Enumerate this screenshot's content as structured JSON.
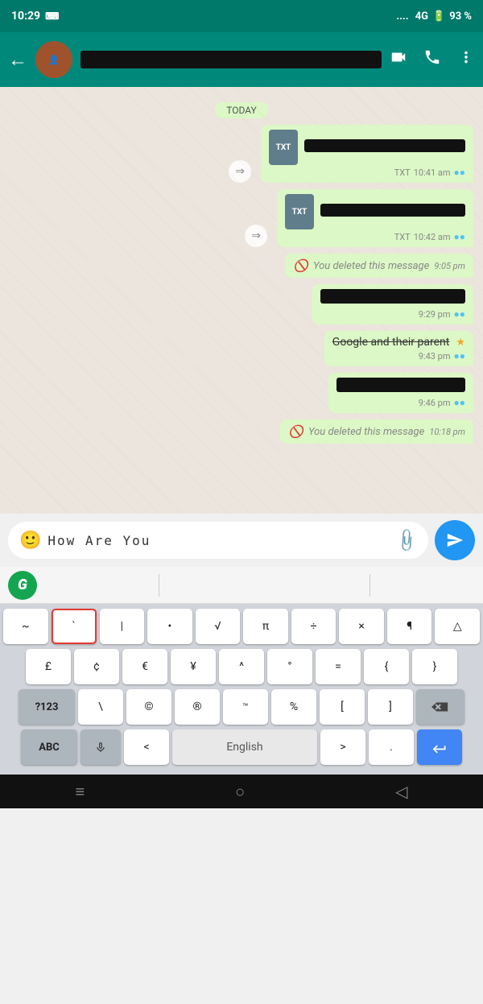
{
  "statusBar": {
    "time": "10:29",
    "signal": "4G",
    "battery": "93 %"
  },
  "appBar": {
    "backLabel": "←",
    "videoCallIcon": "📹",
    "callIcon": "📞",
    "menuIcon": "⋮"
  },
  "dateBadge": "TODAY",
  "messages": [
    {
      "id": "msg1",
      "type": "file",
      "direction": "sent",
      "fileType": "TXT",
      "time": "10:41 am",
      "ticks": "●●"
    },
    {
      "id": "msg2",
      "type": "file",
      "direction": "sent",
      "fileType": "TXT",
      "time": "10:42 am",
      "ticks": "●●"
    },
    {
      "id": "msg3",
      "type": "deleted",
      "direction": "sent",
      "text": "You deleted this message",
      "time": "9:05 pm"
    },
    {
      "id": "msg4",
      "type": "redacted",
      "direction": "sent",
      "time": "9:29 pm",
      "ticks": "●●"
    },
    {
      "id": "msg5",
      "type": "strikethrough",
      "direction": "sent",
      "text": "Google and their parent",
      "time": "9:43 pm",
      "ticks": "●●",
      "star": true
    },
    {
      "id": "msg6",
      "type": "redacted",
      "direction": "sent",
      "time": "9:46 pm",
      "ticks": "●●"
    },
    {
      "id": "msg7",
      "type": "deleted",
      "direction": "sent",
      "text": "You deleted this message",
      "time": "10:18 pm"
    }
  ],
  "inputArea": {
    "text": "How  Are  You",
    "emojiIcon": "🙂",
    "attachIcon": "📎",
    "sendIcon": "➤"
  },
  "keyboard": {
    "row1": [
      "~",
      "`",
      "|",
      "•",
      "√",
      "π",
      "÷",
      "×",
      "¶",
      "△"
    ],
    "row2": [
      "£",
      "¢",
      "€",
      "¥",
      "^",
      "°",
      "=",
      "{",
      "}"
    ],
    "row3Special": [
      "?123",
      "\\",
      "©",
      "®",
      "™",
      "%",
      "[",
      "]",
      "⌫"
    ],
    "bottomRow": {
      "abc": "ABC",
      "mic": "🎤",
      "lt": "<",
      "space": "English",
      "gt": ">",
      "dot": ".",
      "enter": "↵"
    }
  },
  "bottomNav": {
    "home": "≡",
    "circle": "○",
    "back": "◁"
  },
  "grammarly": {
    "letter": "G"
  }
}
